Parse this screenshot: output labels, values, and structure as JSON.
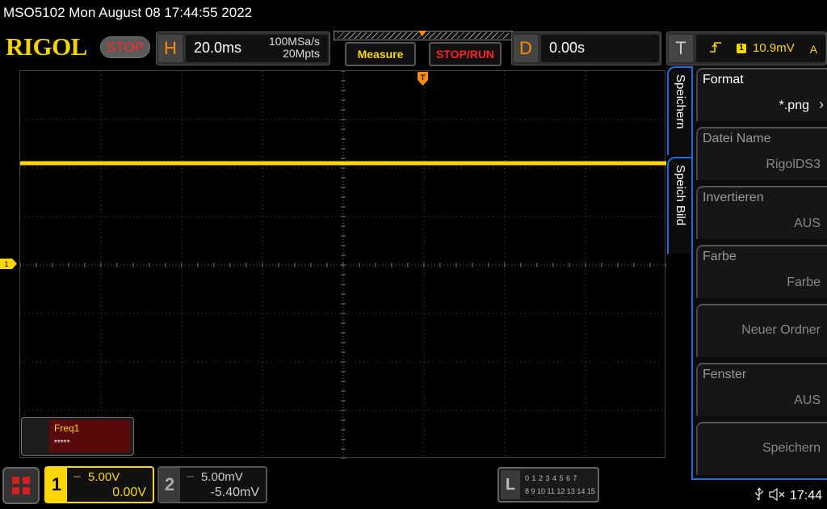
{
  "titlebar": {
    "text": "MSO5102  Mon August 08 17:44:55 2022"
  },
  "brand": {
    "logo": "RIGOL",
    "run_state": "STOP"
  },
  "horizontal": {
    "letter": "H",
    "timebase": "20.0ms",
    "sample_rate": "100MSa/s",
    "memory_depth": "20Mpts"
  },
  "toolbar": {
    "measure_label": "Measure",
    "stoprun_label": "STOP/RUN"
  },
  "delay": {
    "letter": "D",
    "value": "0.00s"
  },
  "trigger": {
    "letter": "T",
    "channel": "1",
    "level": "10.9mV",
    "mode": "A",
    "edge_icon": "rising-edge-icon"
  },
  "markers": {
    "ch1": "1"
  },
  "measurement": {
    "name": "Freq1",
    "value": "*****"
  },
  "side_tabs": [
    "Speichern",
    "Speich Bild"
  ],
  "menu": {
    "items": [
      {
        "title": "Format",
        "value": "*.png"
      },
      {
        "title": "Datei Name",
        "value": "RigolDS3"
      },
      {
        "title": "Invertieren",
        "value": "AUS"
      },
      {
        "title": "Farbe",
        "value": "Farbe"
      },
      {
        "title": "",
        "value": "Neuer Ordner"
      },
      {
        "title": "Fenster",
        "value": "AUS"
      },
      {
        "title": "",
        "value": "Speichern"
      }
    ]
  },
  "channel1": {
    "num": "1",
    "scale": "5.00V",
    "offset": "0.00V"
  },
  "channel2": {
    "num": "2",
    "scale": "5.00mV",
    "offset": "-5.40mV"
  },
  "logic": {
    "letter": "L",
    "row1": "0 1 2 3  4 5 6 7",
    "row2": "8 9 10 11 12 13 14 15"
  },
  "status": {
    "time": "17:44"
  },
  "colors": {
    "ch1": "#ffd700",
    "trigger_marker": "#ff8c00",
    "menu_border": "#1b6fd8",
    "stop": "#ff2020"
  }
}
